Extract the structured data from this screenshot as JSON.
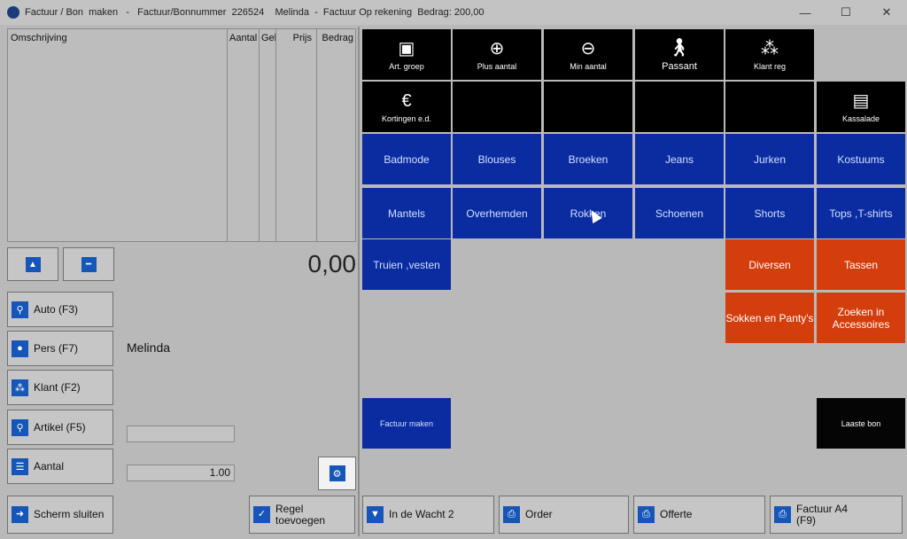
{
  "window": {
    "title": "Factuur / Bon  maken   -   Factuur/Bonnummer  226524    Melinda  -  Factuur Op rekening  Bedrag: 200,00",
    "minimize": "—",
    "maximize": "☐",
    "close": "✕"
  },
  "grid": {
    "columns": [
      "Omschrijving",
      "Aantal",
      "Gel",
      "Prijs",
      "Bedrag"
    ]
  },
  "total": "0,00",
  "left_buttons": {
    "auto": "Auto (F3)",
    "pers": "Pers (F7)",
    "klant": "Klant (F2)",
    "artikel": "Artikel (F5)",
    "aantal": "Aantal"
  },
  "customer_name": "Melinda",
  "article_value": "",
  "quantity_value": "1.00",
  "bottom_buttons": {
    "close": "Scherm sluiten",
    "add_line": "Regel\ntoevoegen",
    "wait": "In de Wacht 2",
    "order": "Order",
    "quote": "Offerte",
    "invoice_a4": "Factuur A4\n(F9)"
  },
  "tiles": {
    "art_groep": "Art. groep",
    "plus_aantal": "Plus aantal",
    "min_aantal": "Min aantal",
    "passant": "Passant",
    "klant_reg": "Klant reg",
    "kortingen": "Kortingen e.d.",
    "kassalade": "Kassalade",
    "badmode": "Badmode",
    "blouses": "Blouses",
    "broeken": "Broeken",
    "jeans": "Jeans",
    "jurken": "Jurken",
    "kostuums": "Kostuums",
    "mantels": "Mantels",
    "overhemden": "Overhemden",
    "rokken": "Rokken",
    "schoenen": "Schoenen",
    "shorts": "Shorts",
    "tops": "Tops ,T-shirts",
    "truien": "Truien ,vesten",
    "diversen": "Diversen",
    "tassen": "Tassen",
    "sokken": "Sokken en Panty's",
    "zoeken": "Zoeken in Accessoires",
    "factuur_maken": "Factuur maken",
    "laaste_bon": "Laaste bon"
  },
  "colors": {
    "black_tile": "#000000",
    "blue_tile": "#0b2ca0",
    "red_tile": "#d43d0c",
    "icon_blue": "#1556b8"
  }
}
